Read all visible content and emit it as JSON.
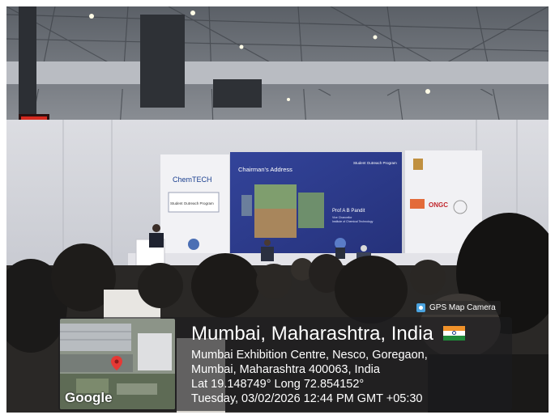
{
  "overlay": {
    "gps_app_label": "GPS Map Camera",
    "map_brand": "Google",
    "place_title": "Mumbai, Maharashtra, India",
    "address_line_1": "Mumbai Exhibition Centre, Nesco, Goregaon,",
    "address_line_2": "Mumbai, Maharashtra 400063, India",
    "coordinates": "Lat 19.148749° Long 72.854152°",
    "datetime": "Tuesday, 03/02/2026 12:44 PM GMT +05:30"
  },
  "stage": {
    "slide_heading": "Chairman's Address",
    "speaker_name": "Prof A B Pandit",
    "speaker_role_1": "Vice Chancellor",
    "speaker_role_2": "Institute of Chemical Technology",
    "program_name": "Student Outreach Program",
    "brand_logo": "ChemTECH",
    "sponsor_logo": "ONGC"
  },
  "colors": {
    "slide_bg": "#2d3e8f",
    "overlay_bg": "#1c1c1e",
    "pin": "#e53935"
  }
}
